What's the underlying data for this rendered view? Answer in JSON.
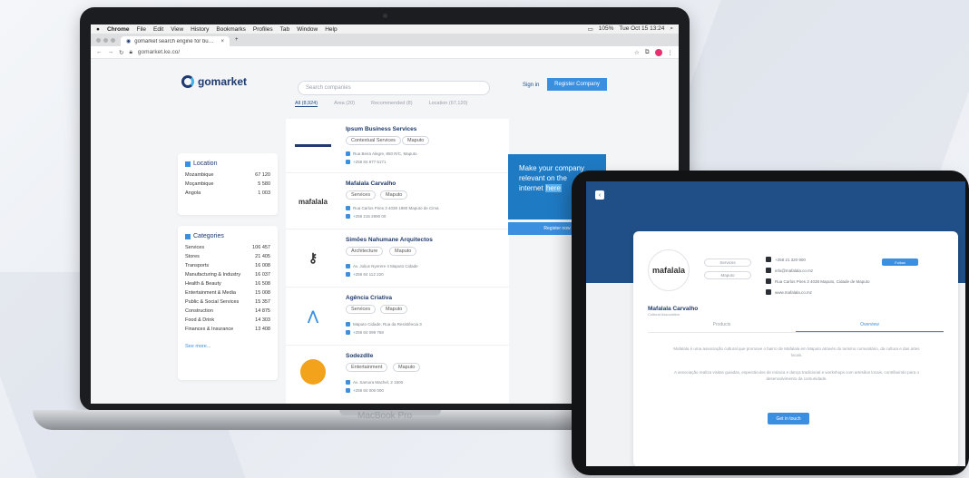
{
  "laptop": {
    "brand": "MacBook Pro",
    "menubar": {
      "apple": "",
      "items": [
        "Chrome",
        "File",
        "Edit",
        "View",
        "History",
        "Bookmarks",
        "Profiles",
        "Tab",
        "Window",
        "Help"
      ],
      "status": [
        "105%",
        "Tue Oct 15 13:24"
      ]
    },
    "browser": {
      "tab_title": "gomarket search engine for bu…",
      "url": "gomarket.ke.co/",
      "new_tab": "+",
      "close_tab": "×"
    },
    "site": {
      "logo_text": "gomarket",
      "search_placeholder": "Search companies",
      "tabs": [
        "All (8,924)",
        "Area (20)",
        "Recommended (8)",
        "Location (67,120)"
      ],
      "signin": "Sign in",
      "register": "Register Company",
      "location": {
        "title": "Location",
        "rows": [
          [
            "Mozambique",
            "67 120"
          ],
          [
            "Moçambique",
            "5 580"
          ],
          [
            "Angola",
            "1 003"
          ]
        ]
      },
      "categories": {
        "title": "Categories",
        "rows": [
          [
            "Services",
            "106 457"
          ],
          [
            "Stores",
            "21 405"
          ],
          [
            "Transports",
            "16 008"
          ],
          [
            "Manufacturing & Industry",
            "16 037"
          ],
          [
            "Health & Beauty",
            "16 508"
          ],
          [
            "Entertainment & Media",
            "15 008"
          ],
          [
            "Public & Social Services",
            "15 357"
          ],
          [
            "Construction",
            "14 875"
          ],
          [
            "Food & Drink",
            "14 303"
          ],
          [
            "Finances & Insurance",
            "13 408"
          ]
        ],
        "see_more": "See more..."
      },
      "results": [
        {
          "name": "Ipsum Business Services",
          "chips": [
            "Contextual Services",
            "Maputo"
          ],
          "lines": [
            "Rua Beira Alegre, 850 R/C, Maputo",
            "+258 84 877 5171"
          ],
          "thumb": ""
        },
        {
          "name": "Mafalala Carvalho",
          "chips": [
            "Services",
            "Maputo"
          ],
          "lines": [
            "Rua Carlos Pires 3 4038 1980 Maputo de Cima",
            "+258 215 2990 00"
          ],
          "thumb": "mafalala"
        },
        {
          "name": "Simões Nahumane Arquitectos",
          "chips": [
            "Architecture",
            "Maputo"
          ],
          "lines": [
            "Av. Julius Nyerere 4 Maputo Cidade",
            "+258 84 112 220"
          ],
          "thumb": ""
        },
        {
          "name": "Agência Criativa",
          "chips": [
            "Services",
            "Maputo"
          ],
          "lines": [
            "Maputo Cidade, Rua da Resistência 3",
            "+258 84 099 768"
          ],
          "thumb": ""
        },
        {
          "name": "Sodezdlle",
          "chips": [
            "Entertainment",
            "Maputo"
          ],
          "lines": [
            "Av. Samora Machel, 2 1500",
            "+258 84 000 000"
          ],
          "thumb": ""
        }
      ],
      "promo": {
        "line1": "Make your company",
        "line2": "relevant on the",
        "line3a": "internet",
        "line3b": "here",
        "button": "Register now"
      }
    }
  },
  "tablet": {
    "back": "‹",
    "logo_text": "mafalala",
    "chips": [
      "Services",
      "Maputo"
    ],
    "info": [
      "+258 21 320 900",
      "info@mafalala.co.mz",
      "Rua Carlos Pires 3 4038 Maputo, Cidade de Maputo",
      "www.mafalala.co.mz"
    ],
    "follow": "Follow",
    "name": "Mafalala Carvalho",
    "subtitle": "Cultural Association",
    "tabs": [
      "Products",
      "Overview"
    ],
    "text1": "Mafalala é uma associação cultural que promove o bairro de Mafalala em Maputo através do turismo comunitário, da cultura e das artes locais.",
    "text2": "A associação realiza visitas guiadas, espectáculos de música e dança tradicional e workshops com artesãos locais, contribuindo para o desenvolvimento da comunidade.",
    "cta": "Get in touch"
  }
}
